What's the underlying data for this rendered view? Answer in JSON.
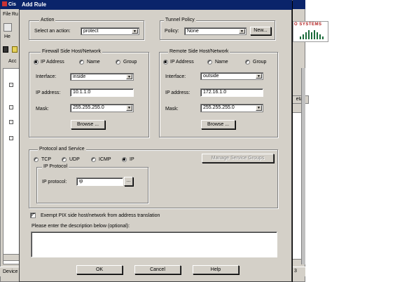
{
  "background_window": {
    "title": "Cis",
    "menu": [
      "File",
      "Ru"
    ],
    "toolbar_label": "He",
    "tab_label": "Acc",
    "logo_text": "O SYSTEMS",
    "detail_button": "etail",
    "status_text": "Device",
    "status_right": "3"
  },
  "dialog": {
    "title": "Add Rule",
    "action": {
      "group_label": "Action",
      "select_label": "Select an action:",
      "value": "protect"
    },
    "tunnel_policy": {
      "group_label": "Tunnel Policy",
      "policy_label": "Policy:",
      "value": "None",
      "new_button": "New..."
    },
    "firewall_side": {
      "group_label": "Firewall Side Host/Network",
      "radios": [
        {
          "label": "IP Address",
          "selected": true
        },
        {
          "label": "Name",
          "selected": false
        },
        {
          "label": "Group",
          "selected": false
        }
      ],
      "interface_label": "Interface:",
      "interface_value": "inside",
      "ip_label": "IP address:",
      "ip_value": "10.1.1.0",
      "mask_label": "Mask:",
      "mask_value": "255.255.255.0",
      "browse_button": "Browse ..."
    },
    "remote_side": {
      "group_label": "Remote Side Host/Network",
      "radios": [
        {
          "label": "IP Address",
          "selected": true
        },
        {
          "label": "Name",
          "selected": false
        },
        {
          "label": "Group",
          "selected": false
        }
      ],
      "interface_label": "Interface:",
      "interface_value": "outside",
      "ip_label": "IP address:",
      "ip_value": "172.16.1.0",
      "mask_label": "Mask:",
      "mask_value": "255.255.255.0",
      "browse_button": "Browse ..."
    },
    "protocol": {
      "group_label": "Protocol and Service",
      "options": [
        {
          "label": "TCP",
          "selected": false
        },
        {
          "label": "UDP",
          "selected": false
        },
        {
          "label": "ICMP",
          "selected": false
        },
        {
          "label": "IP",
          "selected": true
        }
      ],
      "manage_button": "Manage Service Groups",
      "ip_protocol_group": "IP Protocol",
      "ip_protocol_label": "IP protocol:",
      "ip_protocol_value": "ip",
      "ellipsis_button": "..."
    },
    "exempt_checkbox": {
      "label": "Exempt PIX side host/network from address translation",
      "checked": true,
      "mark": "✓"
    },
    "description_label": "Please enter the description below (optional):",
    "description_value": "",
    "buttons": {
      "ok": "OK",
      "cancel": "Cancel",
      "help": "Help"
    }
  }
}
